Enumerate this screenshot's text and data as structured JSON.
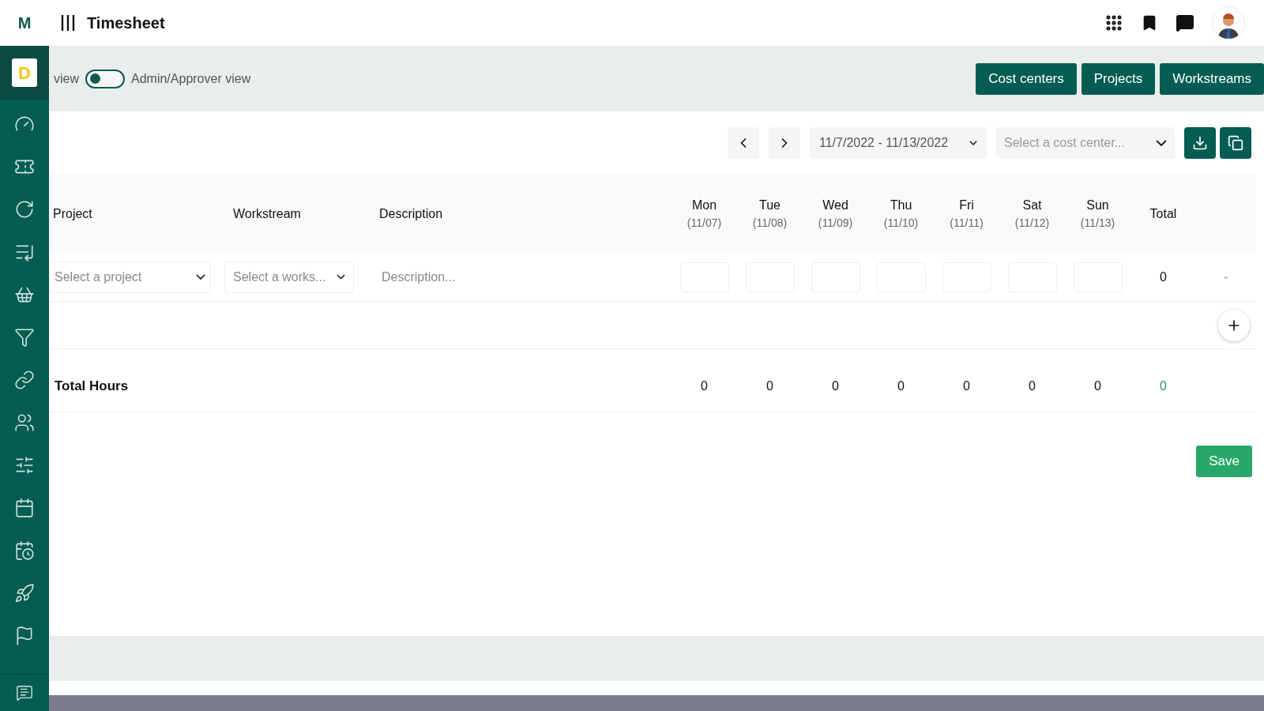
{
  "header": {
    "logo": "M",
    "title": "Timesheet"
  },
  "sidebar": {
    "badge": "D",
    "items": [
      {
        "kind": "gauge",
        "selected": false
      },
      {
        "kind": "ticket",
        "selected": false
      },
      {
        "kind": "refresh",
        "selected": false
      },
      {
        "kind": "list",
        "selected": false
      },
      {
        "kind": "basket",
        "selected": false
      },
      {
        "kind": "filter",
        "selected": false
      },
      {
        "kind": "link",
        "selected": false
      },
      {
        "kind": "users",
        "selected": false
      },
      {
        "kind": "sliders",
        "selected": false
      },
      {
        "kind": "calendar",
        "selected": false
      },
      {
        "kind": "calendar-clock",
        "selected": false
      },
      {
        "kind": "rocket",
        "selected": false
      },
      {
        "kind": "flag",
        "selected": false
      }
    ]
  },
  "view_toggle": {
    "left_label": "view",
    "right_label": "Admin/Approver view",
    "on": false
  },
  "top_buttons": [
    "Cost centers",
    "Projects",
    "Workstreams"
  ],
  "toolbar": {
    "date_range": "11/7/2022 - 11/13/2022",
    "cost_center_placeholder": "Select a cost center..."
  },
  "table": {
    "columns": [
      {
        "label": "Project"
      },
      {
        "label": "Workstream"
      },
      {
        "label": "Description"
      },
      {
        "label": "Mon",
        "date": "(11/07)"
      },
      {
        "label": "Tue",
        "date": "(11/08)"
      },
      {
        "label": "Wed",
        "date": "(11/09)"
      },
      {
        "label": "Thu",
        "date": "(11/10)"
      },
      {
        "label": "Fri",
        "date": "(11/11)"
      },
      {
        "label": "Sat",
        "date": "(11/12)"
      },
      {
        "label": "Sun",
        "date": "(11/13)"
      },
      {
        "label": "Total"
      }
    ],
    "rows": [
      {
        "project_placeholder": "Select a project",
        "workstream_placeholder": "Select a works...",
        "description_placeholder": "Description...",
        "total": "0",
        "action": "-"
      }
    ],
    "totals": {
      "label": "Total Hours",
      "values": [
        "0",
        "0",
        "0",
        "0",
        "0",
        "0",
        "0"
      ],
      "total": "0"
    }
  },
  "save_button": "Save"
}
